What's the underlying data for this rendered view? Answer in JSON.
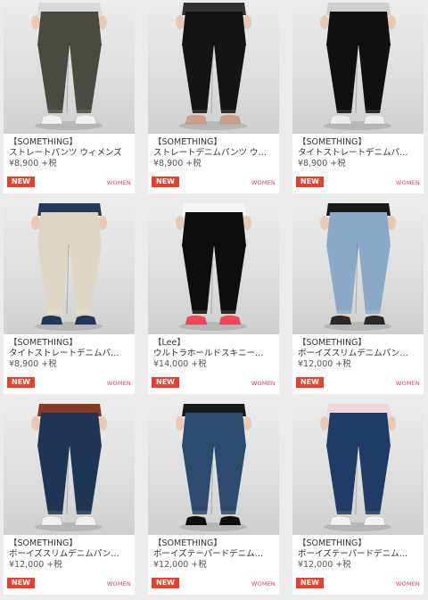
{
  "products": [
    {
      "brand": "【SOMETHING】",
      "title": "ストレートパンツ ウィメンズ",
      "price": "¥8,900 +税",
      "badge": "NEW",
      "gender": "WOMEN",
      "pants_color": "#4b4a42",
      "shoes_color": "#f2f2f2",
      "top_color": "#d9d9d9"
    },
    {
      "brand": "【SOMETHING】",
      "title": "ストレートデニムパンツ ウ…",
      "price": "¥8,900 +税",
      "badge": "NEW",
      "gender": "WOMEN",
      "pants_color": "#141414",
      "shoes_color": "#c9a18a",
      "top_color": "#333333"
    },
    {
      "brand": "【SOMETHING】",
      "title": "タイトストレートデニムパ…",
      "price": "¥8,900 +税",
      "badge": "NEW",
      "gender": "WOMEN",
      "pants_color": "#101010",
      "shoes_color": "#ededed",
      "top_color": "#cfcfcf"
    },
    {
      "brand": "【SOMETHING】",
      "title": "タイトストレートデニムパ…",
      "price": "¥8,900 +税",
      "badge": "NEW",
      "gender": "WOMEN",
      "pants_color": "#ddd5c6",
      "shoes_color": "#24355c",
      "top_color": "#243a5a"
    },
    {
      "brand": "【Lee】",
      "title": "ウルトラホールドスキニー…",
      "price": "¥14,000 +税",
      "badge": "NEW",
      "gender": "WOMEN",
      "pants_color": "#0d0d0d",
      "shoes_color": "#f2445a",
      "top_color": "#f5f5f5"
    },
    {
      "brand": "【SOMETHING】",
      "title": "ボーイズスリムデニムパン…",
      "price": "¥12,000 +税",
      "badge": "NEW",
      "gender": "WOMEN",
      "pants_color": "#8aa8c8",
      "shoes_color": "#2a2a2a",
      "top_color": "#1a1a1a"
    },
    {
      "brand": "【SOMETHING】",
      "title": "ボーイズスリムデニムパン…",
      "price": "¥12,000 +税",
      "badge": "NEW",
      "gender": "WOMEN",
      "pants_color": "#1f3556",
      "shoes_color": "#f0f0f0",
      "top_color": "#8a3a22"
    },
    {
      "brand": "【SOMETHING】",
      "title": "ボーイズテーパードデニム…",
      "price": "¥12,000 +税",
      "badge": "NEW",
      "gender": "WOMEN",
      "pants_color": "#2c4b6e",
      "shoes_color": "#0f0f0f",
      "top_color": "#1a1a1a"
    },
    {
      "brand": "【SOMETHING】",
      "title": "ボーイズテーパードデニム…",
      "price": "¥12,000 +税",
      "badge": "NEW",
      "gender": "WOMEN",
      "pants_color": "#1f3b66",
      "shoes_color": "#f2f2f2",
      "top_color": "#f2d7d9"
    }
  ]
}
